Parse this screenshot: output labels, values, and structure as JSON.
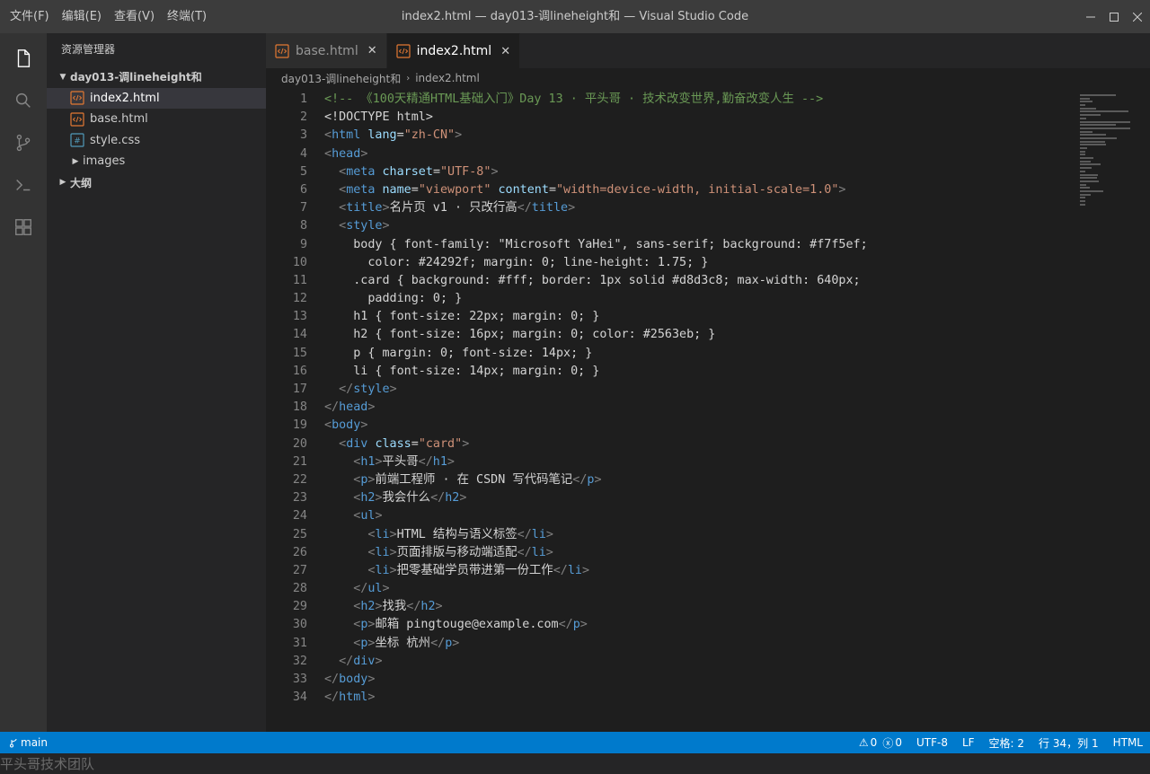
{
  "menu": [
    "文件(F)",
    "编辑(E)",
    "查看(V)",
    "终端(T)"
  ],
  "window_title": "index2.html — day013-调lineheight和 — Visual Studio Code",
  "sidebar": {
    "title": "资源管理器",
    "folder": "day013-调lineheight和",
    "files": [
      {
        "name": "index2.html",
        "icon": "html-file-icon",
        "active": true
      },
      {
        "name": "base.html",
        "icon": "html-file-icon",
        "active": false
      },
      {
        "name": "style.css",
        "icon": "css-file-icon",
        "active": false
      }
    ],
    "subfolder": "images",
    "outline": "大纲"
  },
  "tabs": [
    {
      "label": "base.html",
      "active": false
    },
    {
      "label": "index2.html",
      "active": true
    }
  ],
  "breadcrumb": [
    "day013-调lineheight和",
    "index2.html"
  ],
  "code_lines": [
    [
      [
        "c",
        "<!-- 《100天精通HTML基础入门》Day 13 · 平头哥 · 技术改变世界,勤奋改变人生 -->"
      ]
    ],
    [
      [
        "d",
        "<!DOCTYPE html>"
      ]
    ],
    [
      [
        "p",
        "<"
      ],
      [
        "t",
        "html"
      ],
      [
        "d",
        " "
      ],
      [
        "a",
        "lang"
      ],
      [
        "d",
        "="
      ],
      [
        "s",
        "\"zh-CN\""
      ],
      [
        "p",
        ">"
      ]
    ],
    [
      [
        "p",
        "<"
      ],
      [
        "t",
        "head"
      ],
      [
        "p",
        ">"
      ]
    ],
    [
      [
        "d",
        "  "
      ],
      [
        "p",
        "<"
      ],
      [
        "t",
        "meta"
      ],
      [
        "d",
        " "
      ],
      [
        "a",
        "charset"
      ],
      [
        "d",
        "="
      ],
      [
        "s",
        "\"UTF-8\""
      ],
      [
        "p",
        ">"
      ]
    ],
    [
      [
        "d",
        "  "
      ],
      [
        "p",
        "<"
      ],
      [
        "t",
        "meta"
      ],
      [
        "d",
        " "
      ],
      [
        "a",
        "name"
      ],
      [
        "d",
        "="
      ],
      [
        "s",
        "\"viewport\""
      ],
      [
        "d",
        " "
      ],
      [
        "a",
        "content"
      ],
      [
        "d",
        "="
      ],
      [
        "s",
        "\"width=device-width, initial-scale=1.0\""
      ],
      [
        "p",
        ">"
      ]
    ],
    [
      [
        "d",
        "  "
      ],
      [
        "p",
        "<"
      ],
      [
        "t",
        "title"
      ],
      [
        "p",
        ">"
      ],
      [
        "d",
        "名片页 v1 · 只改行高"
      ],
      [
        "p",
        "</"
      ],
      [
        "t",
        "title"
      ],
      [
        "p",
        ">"
      ]
    ],
    [
      [
        "d",
        "  "
      ],
      [
        "p",
        "<"
      ],
      [
        "t",
        "style"
      ],
      [
        "p",
        ">"
      ]
    ],
    [
      [
        "d",
        "    body { font-family: \"Microsoft YaHei\", sans-serif; background: #f7f5ef;"
      ]
    ],
    [
      [
        "d",
        "      color: #24292f; margin: 0; line-height: 1.75; }"
      ]
    ],
    [
      [
        "d",
        "    .card { background: #fff; border: 1px solid #d8d3c8; max-width: 640px;"
      ]
    ],
    [
      [
        "d",
        "      padding: 0; }"
      ]
    ],
    [
      [
        "d",
        "    h1 { font-size: 22px; margin: 0; }"
      ]
    ],
    [
      [
        "d",
        "    h2 { font-size: 16px; margin: 0; color: #2563eb; }"
      ]
    ],
    [
      [
        "d",
        "    p { margin: 0; font-size: 14px; }"
      ]
    ],
    [
      [
        "d",
        "    li { font-size: 14px; margin: 0; }"
      ]
    ],
    [
      [
        "d",
        "  "
      ],
      [
        "p",
        "</"
      ],
      [
        "t",
        "style"
      ],
      [
        "p",
        ">"
      ]
    ],
    [
      [
        "p",
        "</"
      ],
      [
        "t",
        "head"
      ],
      [
        "p",
        ">"
      ]
    ],
    [
      [
        "p",
        "<"
      ],
      [
        "t",
        "body"
      ],
      [
        "p",
        ">"
      ]
    ],
    [
      [
        "d",
        "  "
      ],
      [
        "p",
        "<"
      ],
      [
        "t",
        "div"
      ],
      [
        "d",
        " "
      ],
      [
        "a",
        "class"
      ],
      [
        "d",
        "="
      ],
      [
        "s",
        "\"card\""
      ],
      [
        "p",
        ">"
      ]
    ],
    [
      [
        "d",
        "    "
      ],
      [
        "p",
        "<"
      ],
      [
        "t",
        "h1"
      ],
      [
        "p",
        ">"
      ],
      [
        "d",
        "平头哥"
      ],
      [
        "p",
        "</"
      ],
      [
        "t",
        "h1"
      ],
      [
        "p",
        ">"
      ]
    ],
    [
      [
        "d",
        "    "
      ],
      [
        "p",
        "<"
      ],
      [
        "t",
        "p"
      ],
      [
        "p",
        ">"
      ],
      [
        "d",
        "前端工程师 · 在 CSDN 写代码笔记"
      ],
      [
        "p",
        "</"
      ],
      [
        "t",
        "p"
      ],
      [
        "p",
        ">"
      ]
    ],
    [
      [
        "d",
        "    "
      ],
      [
        "p",
        "<"
      ],
      [
        "t",
        "h2"
      ],
      [
        "p",
        ">"
      ],
      [
        "d",
        "我会什么"
      ],
      [
        "p",
        "</"
      ],
      [
        "t",
        "h2"
      ],
      [
        "p",
        ">"
      ]
    ],
    [
      [
        "d",
        "    "
      ],
      [
        "p",
        "<"
      ],
      [
        "t",
        "ul"
      ],
      [
        "p",
        ">"
      ]
    ],
    [
      [
        "d",
        "      "
      ],
      [
        "p",
        "<"
      ],
      [
        "t",
        "li"
      ],
      [
        "p",
        ">"
      ],
      [
        "d",
        "HTML 结构与语义标签"
      ],
      [
        "p",
        "</"
      ],
      [
        "t",
        "li"
      ],
      [
        "p",
        ">"
      ]
    ],
    [
      [
        "d",
        "      "
      ],
      [
        "p",
        "<"
      ],
      [
        "t",
        "li"
      ],
      [
        "p",
        ">"
      ],
      [
        "d",
        "页面排版与移动端适配"
      ],
      [
        "p",
        "</"
      ],
      [
        "t",
        "li"
      ],
      [
        "p",
        ">"
      ]
    ],
    [
      [
        "d",
        "      "
      ],
      [
        "p",
        "<"
      ],
      [
        "t",
        "li"
      ],
      [
        "p",
        ">"
      ],
      [
        "d",
        "把零基础学员带进第一份工作"
      ],
      [
        "p",
        "</"
      ],
      [
        "t",
        "li"
      ],
      [
        "p",
        ">"
      ]
    ],
    [
      [
        "d",
        "    "
      ],
      [
        "p",
        "</"
      ],
      [
        "t",
        "ul"
      ],
      [
        "p",
        ">"
      ]
    ],
    [
      [
        "d",
        "    "
      ],
      [
        "p",
        "<"
      ],
      [
        "t",
        "h2"
      ],
      [
        "p",
        ">"
      ],
      [
        "d",
        "找我"
      ],
      [
        "p",
        "</"
      ],
      [
        "t",
        "h2"
      ],
      [
        "p",
        ">"
      ]
    ],
    [
      [
        "d",
        "    "
      ],
      [
        "p",
        "<"
      ],
      [
        "t",
        "p"
      ],
      [
        "p",
        ">"
      ],
      [
        "d",
        "邮箱 pingtouge@example.com"
      ],
      [
        "p",
        "</"
      ],
      [
        "t",
        "p"
      ],
      [
        "p",
        ">"
      ]
    ],
    [
      [
        "d",
        "    "
      ],
      [
        "p",
        "<"
      ],
      [
        "t",
        "p"
      ],
      [
        "p",
        ">"
      ],
      [
        "d",
        "坐标 杭州"
      ],
      [
        "p",
        "</"
      ],
      [
        "t",
        "p"
      ],
      [
        "p",
        ">"
      ]
    ],
    [
      [
        "d",
        "  "
      ],
      [
        "p",
        "</"
      ],
      [
        "t",
        "div"
      ],
      [
        "p",
        ">"
      ]
    ],
    [
      [
        "p",
        "</"
      ],
      [
        "t",
        "body"
      ],
      [
        "p",
        ">"
      ]
    ],
    [
      [
        "p",
        "</"
      ],
      [
        "t",
        "html"
      ],
      [
        "p",
        ">"
      ]
    ]
  ],
  "statusbar": {
    "branch": "main",
    "warnings": "0",
    "errors": "0",
    "encoding": "UTF-8",
    "eol": "LF",
    "indent": "空格: 2",
    "position": "行 34，列 1",
    "language": "HTML"
  },
  "watermark": "平头哥技术团队",
  "colors": {
    "accent": "#007acc",
    "comment": "#6a9955",
    "tag": "#569cd6",
    "attr": "#9cdcfe",
    "string": "#ce9178",
    "html_icon": "#e37933",
    "css_icon": "#519aba"
  }
}
